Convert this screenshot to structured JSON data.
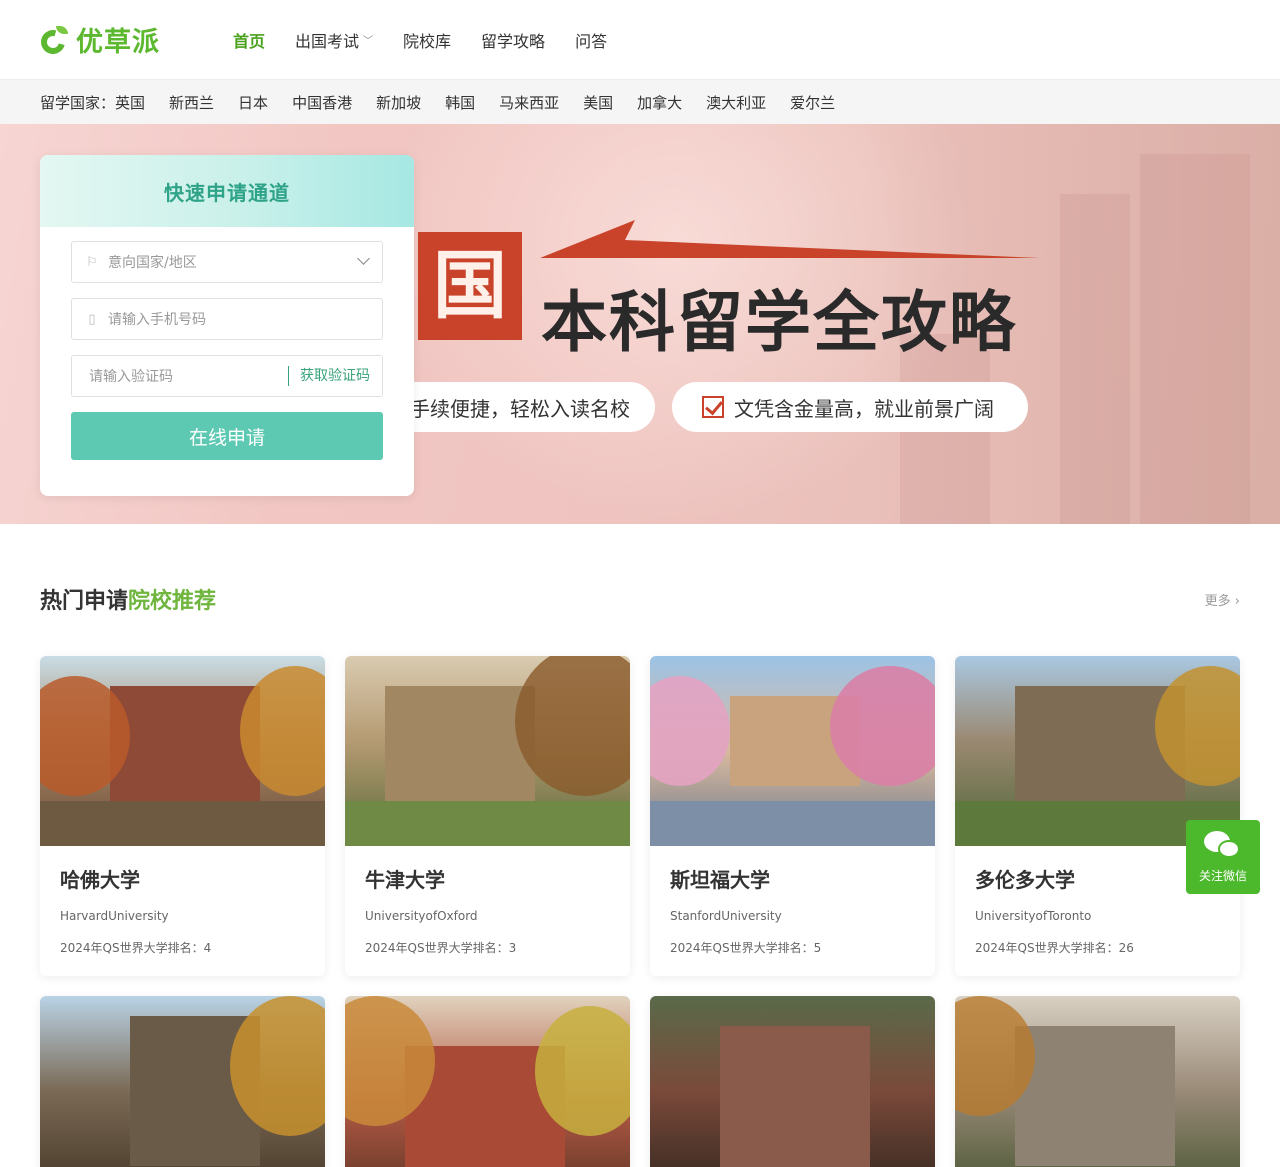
{
  "header": {
    "logo_text": "优草派",
    "nav": [
      {
        "label": "首页",
        "active": true
      },
      {
        "label": "出国考试",
        "has_dropdown": true
      },
      {
        "label": "院校库"
      },
      {
        "label": "留学攻略"
      },
      {
        "label": "问答"
      }
    ]
  },
  "country_bar": {
    "label": "留学国家：",
    "countries": [
      "英国",
      "新西兰",
      "日本",
      "中国香港",
      "新加坡",
      "韩国",
      "马来西亚",
      "美国",
      "加拿大",
      "澳大利亚",
      "爱尔兰"
    ]
  },
  "banner": {
    "big_char": "国",
    "title": "本科留学全攻略",
    "pill1": "手续便捷，轻松入读名校",
    "pill2": "文凭含金量高，就业前景广阔",
    "accent_color": "#c9432a"
  },
  "form": {
    "title": "快速申请通道",
    "region_placeholder": "意向国家/地区",
    "phone_placeholder": "请输入手机号码",
    "code_placeholder": "请输入验证码",
    "get_code_label": "获取验证码",
    "submit_label": "在线申请",
    "submit_color": "#5dc9b2"
  },
  "section": {
    "title_part1": "热门申请",
    "title_part2": "院校推荐",
    "more_label": "更多 ›"
  },
  "universities": [
    {
      "name": "哈佛大学",
      "en": "HarvardUniversity",
      "rank": "2024年QS世界大学排名：4"
    },
    {
      "name": "牛津大学",
      "en": "UniversityofOxford",
      "rank": "2024年QS世界大学排名：3"
    },
    {
      "name": "斯坦福大学",
      "en": "StanfordUniversity",
      "rank": "2024年QS世界大学排名：5"
    },
    {
      "name": "多伦多大学",
      "en": "UniversityofToronto",
      "rank": "2024年QS世界大学排名：26"
    }
  ],
  "wechat": {
    "label": "关注微信",
    "color": "#4cb82c"
  }
}
